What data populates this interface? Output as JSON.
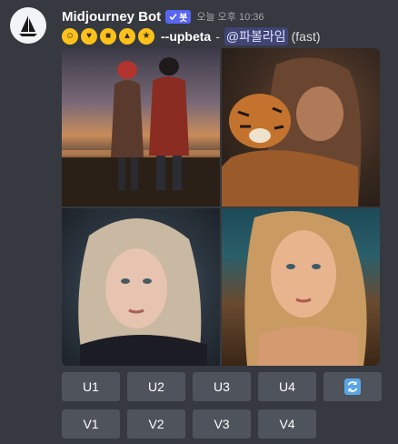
{
  "message": {
    "author": "Midjourney Bot",
    "bot_badge": "봇",
    "timestamp": "오늘 오후 10:36",
    "emojis": [
      "smiling-face-icon",
      "smiling-face-with-hearts-icon",
      "sunglasses-face-icon",
      "party-face-icon",
      "star-struck-face-icon"
    ],
    "prompt": "--upbeta",
    "separator": "-",
    "mention": "@파볼라임",
    "mode": "(fast)"
  },
  "image_grid": {
    "cells": [
      {
        "name": "grid-image-1"
      },
      {
        "name": "grid-image-2"
      },
      {
        "name": "grid-image-3"
      },
      {
        "name": "grid-image-4"
      }
    ]
  },
  "buttons": {
    "upscale": [
      "U1",
      "U2",
      "U3",
      "U4"
    ],
    "variation": [
      "V1",
      "V2",
      "V3",
      "V4"
    ],
    "reroll_icon": "refresh-icon",
    "reroll_color": "#5aa7e8"
  },
  "colors": {
    "background": "#36393f",
    "button": "#4f545c",
    "bot_tag": "#5865f2",
    "mention_bg": "#414675"
  }
}
